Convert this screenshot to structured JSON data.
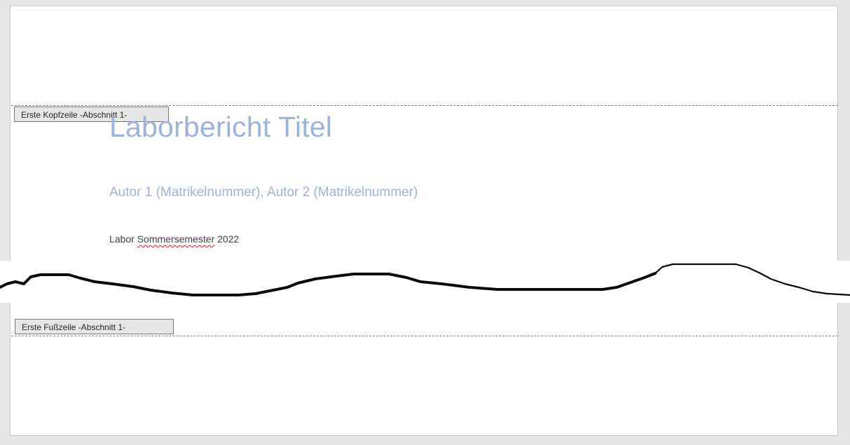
{
  "header_tag": "Erste Kopfzeile -Abschnitt 1-",
  "footer_tag": "Erste Fußzeile -Abschnitt 1-",
  "document": {
    "title": "Laborbericht Titel",
    "subtitle": "Autor 1 (Matrikelnummer), Autor 2 (Matrikelnummer)",
    "semester_prefix": "Labor",
    "semester_word": "Sommersemester",
    "semester_year": "2022"
  },
  "colors": {
    "title": "#9db3de",
    "body_text": "#404040",
    "spellcheck_underline": "#e81123",
    "page_bg": "#ffffff",
    "workspace_bg": "#e6e6e6"
  }
}
